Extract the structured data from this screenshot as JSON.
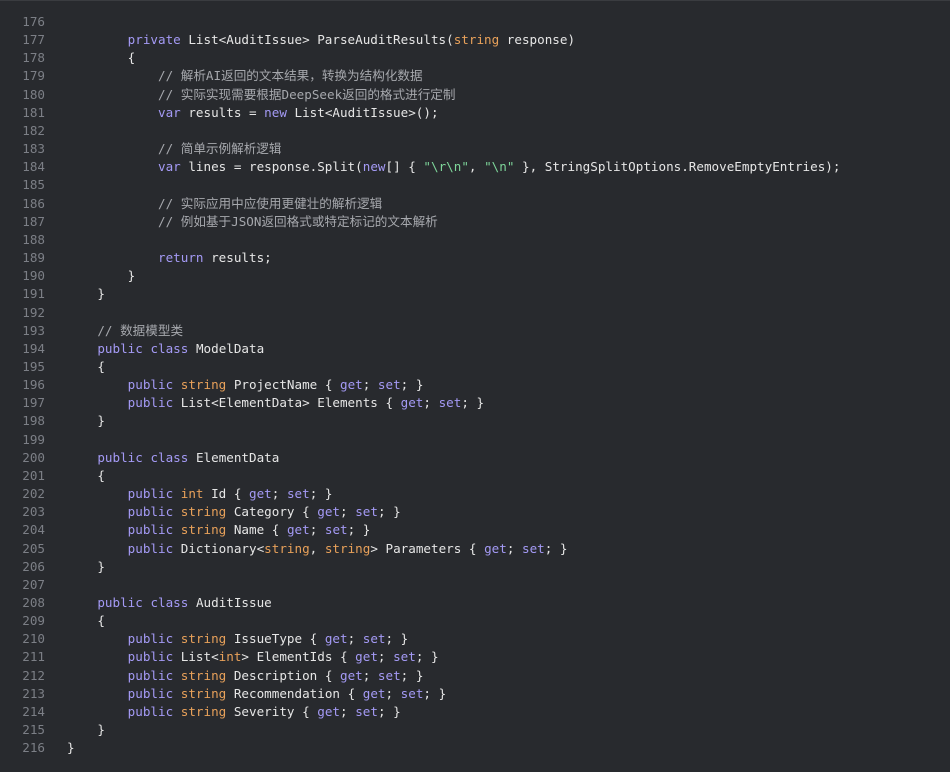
{
  "editor": {
    "colors": {
      "background": "#282a2e",
      "line_number": "#7c7f86",
      "keyword": "#a49af5",
      "type": "#e8a15a",
      "string": "#7ed69a",
      "comment": "#a6a8ad",
      "plain": "#e6e6e6"
    },
    "lines": [
      {
        "n": "176",
        "tokens": []
      },
      {
        "n": "177",
        "tokens": [
          [
            "pl",
            "        "
          ],
          [
            "kw",
            "private"
          ],
          [
            "pl",
            " List<AuditIssue> ParseAuditResults("
          ],
          [
            "type",
            "string"
          ],
          [
            "pl",
            " response)"
          ]
        ]
      },
      {
        "n": "178",
        "tokens": [
          [
            "pl",
            "        {"
          ]
        ]
      },
      {
        "n": "179",
        "tokens": [
          [
            "pl",
            "            "
          ],
          [
            "cm",
            "// 解析AI返回的文本结果，转换为结构化数据"
          ]
        ]
      },
      {
        "n": "180",
        "tokens": [
          [
            "pl",
            "            "
          ],
          [
            "cm",
            "// 实际实现需要根据DeepSeek返回的格式进行定制"
          ]
        ]
      },
      {
        "n": "181",
        "tokens": [
          [
            "pl",
            "            "
          ],
          [
            "kw",
            "var"
          ],
          [
            "pl",
            " results = "
          ],
          [
            "kw",
            "new"
          ],
          [
            "pl",
            " List<AuditIssue>();"
          ]
        ]
      },
      {
        "n": "182",
        "tokens": []
      },
      {
        "n": "183",
        "tokens": [
          [
            "pl",
            "            "
          ],
          [
            "cm",
            "// 简单示例解析逻辑"
          ]
        ]
      },
      {
        "n": "184",
        "tokens": [
          [
            "pl",
            "            "
          ],
          [
            "kw",
            "var"
          ],
          [
            "pl",
            " lines = response.Split("
          ],
          [
            "kw",
            "new"
          ],
          [
            "pl",
            "[] { "
          ],
          [
            "str",
            "\"\\r\\n\""
          ],
          [
            "pl",
            ", "
          ],
          [
            "str",
            "\"\\n\""
          ],
          [
            "pl",
            " }, StringSplitOptions.RemoveEmptyEntries);"
          ]
        ]
      },
      {
        "n": "185",
        "tokens": []
      },
      {
        "n": "186",
        "tokens": [
          [
            "pl",
            "            "
          ],
          [
            "cm",
            "// 实际应用中应使用更健壮的解析逻辑"
          ]
        ]
      },
      {
        "n": "187",
        "tokens": [
          [
            "pl",
            "            "
          ],
          [
            "cm",
            "// 例如基于JSON返回格式或特定标记的文本解析"
          ]
        ]
      },
      {
        "n": "188",
        "tokens": []
      },
      {
        "n": "189",
        "tokens": [
          [
            "pl",
            "            "
          ],
          [
            "kw",
            "return"
          ],
          [
            "pl",
            " results;"
          ]
        ]
      },
      {
        "n": "190",
        "tokens": [
          [
            "pl",
            "        }"
          ]
        ]
      },
      {
        "n": "191",
        "tokens": [
          [
            "pl",
            "    }"
          ]
        ]
      },
      {
        "n": "192",
        "tokens": []
      },
      {
        "n": "193",
        "tokens": [
          [
            "pl",
            "    "
          ],
          [
            "cm",
            "// 数据模型类"
          ]
        ]
      },
      {
        "n": "194",
        "tokens": [
          [
            "pl",
            "    "
          ],
          [
            "kw",
            "public"
          ],
          [
            "pl",
            " "
          ],
          [
            "kw",
            "class"
          ],
          [
            "pl",
            " ModelData"
          ]
        ]
      },
      {
        "n": "195",
        "tokens": [
          [
            "pl",
            "    {"
          ]
        ]
      },
      {
        "n": "196",
        "tokens": [
          [
            "pl",
            "        "
          ],
          [
            "kw",
            "public"
          ],
          [
            "pl",
            " "
          ],
          [
            "type",
            "string"
          ],
          [
            "pl",
            " ProjectName { "
          ],
          [
            "kw",
            "get"
          ],
          [
            "pl",
            "; "
          ],
          [
            "kw",
            "set"
          ],
          [
            "pl",
            "; }"
          ]
        ]
      },
      {
        "n": "197",
        "tokens": [
          [
            "pl",
            "        "
          ],
          [
            "kw",
            "public"
          ],
          [
            "pl",
            " List<ElementData> Elements { "
          ],
          [
            "kw",
            "get"
          ],
          [
            "pl",
            "; "
          ],
          [
            "kw",
            "set"
          ],
          [
            "pl",
            "; }"
          ]
        ]
      },
      {
        "n": "198",
        "tokens": [
          [
            "pl",
            "    }"
          ]
        ]
      },
      {
        "n": "199",
        "tokens": []
      },
      {
        "n": "200",
        "tokens": [
          [
            "pl",
            "    "
          ],
          [
            "kw",
            "public"
          ],
          [
            "pl",
            " "
          ],
          [
            "kw",
            "class"
          ],
          [
            "pl",
            " ElementData"
          ]
        ]
      },
      {
        "n": "201",
        "tokens": [
          [
            "pl",
            "    {"
          ]
        ]
      },
      {
        "n": "202",
        "tokens": [
          [
            "pl",
            "        "
          ],
          [
            "kw",
            "public"
          ],
          [
            "pl",
            " "
          ],
          [
            "type",
            "int"
          ],
          [
            "pl",
            " Id { "
          ],
          [
            "kw",
            "get"
          ],
          [
            "pl",
            "; "
          ],
          [
            "kw",
            "set"
          ],
          [
            "pl",
            "; }"
          ]
        ]
      },
      {
        "n": "203",
        "tokens": [
          [
            "pl",
            "        "
          ],
          [
            "kw",
            "public"
          ],
          [
            "pl",
            " "
          ],
          [
            "type",
            "string"
          ],
          [
            "pl",
            " Category { "
          ],
          [
            "kw",
            "get"
          ],
          [
            "pl",
            "; "
          ],
          [
            "kw",
            "set"
          ],
          [
            "pl",
            "; }"
          ]
        ]
      },
      {
        "n": "204",
        "tokens": [
          [
            "pl",
            "        "
          ],
          [
            "kw",
            "public"
          ],
          [
            "pl",
            " "
          ],
          [
            "type",
            "string"
          ],
          [
            "pl",
            " Name { "
          ],
          [
            "kw",
            "get"
          ],
          [
            "pl",
            "; "
          ],
          [
            "kw",
            "set"
          ],
          [
            "pl",
            "; }"
          ]
        ]
      },
      {
        "n": "205",
        "tokens": [
          [
            "pl",
            "        "
          ],
          [
            "kw",
            "public"
          ],
          [
            "pl",
            " Dictionary<"
          ],
          [
            "type",
            "string"
          ],
          [
            "pl",
            ", "
          ],
          [
            "type",
            "string"
          ],
          [
            "pl",
            "> Parameters { "
          ],
          [
            "kw",
            "get"
          ],
          [
            "pl",
            "; "
          ],
          [
            "kw",
            "set"
          ],
          [
            "pl",
            "; }"
          ]
        ]
      },
      {
        "n": "206",
        "tokens": [
          [
            "pl",
            "    }"
          ]
        ]
      },
      {
        "n": "207",
        "tokens": []
      },
      {
        "n": "208",
        "tokens": [
          [
            "pl",
            "    "
          ],
          [
            "kw",
            "public"
          ],
          [
            "pl",
            " "
          ],
          [
            "kw",
            "class"
          ],
          [
            "pl",
            " AuditIssue"
          ]
        ]
      },
      {
        "n": "209",
        "tokens": [
          [
            "pl",
            "    {"
          ]
        ]
      },
      {
        "n": "210",
        "tokens": [
          [
            "pl",
            "        "
          ],
          [
            "kw",
            "public"
          ],
          [
            "pl",
            " "
          ],
          [
            "type",
            "string"
          ],
          [
            "pl",
            " IssueType { "
          ],
          [
            "kw",
            "get"
          ],
          [
            "pl",
            "; "
          ],
          [
            "kw",
            "set"
          ],
          [
            "pl",
            "; }"
          ]
        ]
      },
      {
        "n": "211",
        "tokens": [
          [
            "pl",
            "        "
          ],
          [
            "kw",
            "public"
          ],
          [
            "pl",
            " List<"
          ],
          [
            "type",
            "int"
          ],
          [
            "pl",
            "> ElementIds { "
          ],
          [
            "kw",
            "get"
          ],
          [
            "pl",
            "; "
          ],
          [
            "kw",
            "set"
          ],
          [
            "pl",
            "; }"
          ]
        ]
      },
      {
        "n": "212",
        "tokens": [
          [
            "pl",
            "        "
          ],
          [
            "kw",
            "public"
          ],
          [
            "pl",
            " "
          ],
          [
            "type",
            "string"
          ],
          [
            "pl",
            " Description { "
          ],
          [
            "kw",
            "get"
          ],
          [
            "pl",
            "; "
          ],
          [
            "kw",
            "set"
          ],
          [
            "pl",
            "; }"
          ]
        ]
      },
      {
        "n": "213",
        "tokens": [
          [
            "pl",
            "        "
          ],
          [
            "kw",
            "public"
          ],
          [
            "pl",
            " "
          ],
          [
            "type",
            "string"
          ],
          [
            "pl",
            " Recommendation { "
          ],
          [
            "kw",
            "get"
          ],
          [
            "pl",
            "; "
          ],
          [
            "kw",
            "set"
          ],
          [
            "pl",
            "; }"
          ]
        ]
      },
      {
        "n": "214",
        "tokens": [
          [
            "pl",
            "        "
          ],
          [
            "kw",
            "public"
          ],
          [
            "pl",
            " "
          ],
          [
            "type",
            "string"
          ],
          [
            "pl",
            " Severity { "
          ],
          [
            "kw",
            "get"
          ],
          [
            "pl",
            "; "
          ],
          [
            "kw",
            "set"
          ],
          [
            "pl",
            "; }"
          ]
        ]
      },
      {
        "n": "215",
        "tokens": [
          [
            "pl",
            "    }"
          ]
        ]
      },
      {
        "n": "216",
        "tokens": [
          [
            "pl",
            "}"
          ]
        ]
      }
    ]
  }
}
